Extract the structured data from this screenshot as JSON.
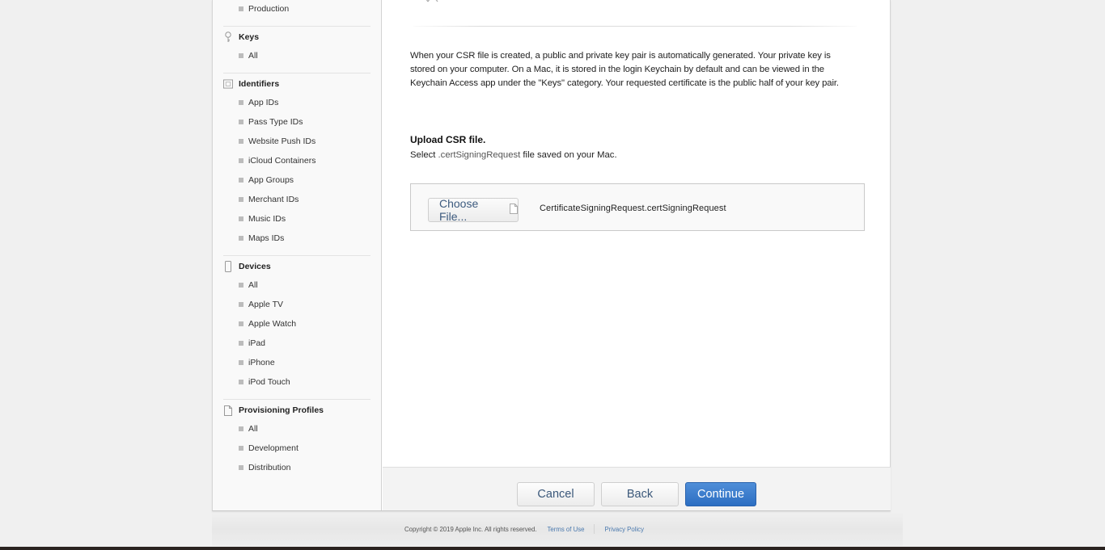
{
  "sidebar": {
    "top_item": "Production",
    "sections": [
      {
        "title": "Keys",
        "icon": "key-icon",
        "items": [
          "All"
        ]
      },
      {
        "title": "Identifiers",
        "icon": "id-card-icon",
        "items": [
          "App IDs",
          "Pass Type IDs",
          "Website Push IDs",
          "iCloud Containers",
          "App Groups",
          "Merchant IDs",
          "Music IDs",
          "Maps IDs"
        ]
      },
      {
        "title": "Devices",
        "icon": "device-icon",
        "items": [
          "All",
          "Apple TV",
          "Apple Watch",
          "iPad",
          "iPhone",
          "iPod Touch"
        ]
      },
      {
        "title": "Provisioning Profiles",
        "icon": "document-icon",
        "items": [
          "All",
          "Development",
          "Distribution"
        ]
      }
    ]
  },
  "main": {
    "description": "When your CSR file is created, a public and private key pair is automatically generated. Your private key is stored on your computer. On a Mac, it is stored in the login Keychain by default and can be viewed in the Keychain Access app under the \"Keys\" category. Your requested certificate is the public half of your key pair.",
    "upload_title": "Upload CSR file.",
    "upload_sub_prefix": "Select ",
    "upload_sub_ext": ".certSigningRequest",
    "upload_sub_suffix": " file saved on your Mac.",
    "choose_file_label": "Choose File...",
    "selected_file": "CertificateSigningRequest.certSigningRequest"
  },
  "buttons": {
    "cancel": "Cancel",
    "back": "Back",
    "continue": "Continue"
  },
  "footer": {
    "copyright": "Copyright © 2019 Apple Inc. All rights reserved.",
    "terms": "Terms of Use",
    "privacy": "Privacy Policy"
  },
  "colors": {
    "primary_button": "#2f72c4",
    "link": "#4a79ae"
  }
}
